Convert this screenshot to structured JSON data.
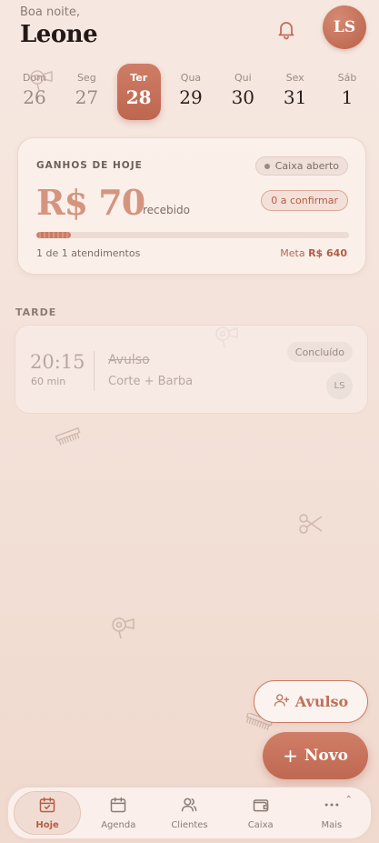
{
  "header": {
    "greeting": "Boa noite,",
    "user_name": "Leone",
    "avatar_initials": "LS",
    "bell_icon": "bell-icon"
  },
  "week": [
    {
      "name": "Dom",
      "date": "26",
      "state": "past"
    },
    {
      "name": "Seg",
      "date": "27",
      "state": "past"
    },
    {
      "name": "Ter",
      "date": "28",
      "state": "active"
    },
    {
      "name": "Qua",
      "date": "29",
      "state": "future"
    },
    {
      "name": "Qui",
      "date": "30",
      "state": "future"
    },
    {
      "name": "Sex",
      "date": "31",
      "state": "future"
    },
    {
      "name": "Sáb",
      "date": "1",
      "state": "future"
    }
  ],
  "earnings": {
    "title": "GANHOS DE HOJE",
    "cash_status": "Caixa aberto",
    "amount": "R$ 70",
    "amount_label": "recebido",
    "to_confirm": "0 a confirmar",
    "progress_fraction": 0.11,
    "attendance_text": "1 de 1 atendimentos",
    "goal_label": "Meta",
    "goal_value": "R$ 640"
  },
  "section": {
    "title": "TARDE"
  },
  "appointment": {
    "time": "20:15",
    "duration": "60 min",
    "client": "Avulso",
    "service": "Corte + Barba",
    "status": "Concluído",
    "initials": "LS"
  },
  "actions": {
    "walkin_label": "Avulso",
    "new_label": "Novo",
    "new_plus": "+"
  },
  "nav": [
    {
      "label": "Hoje",
      "icon": "calendar-check-icon",
      "active": true
    },
    {
      "label": "Agenda",
      "icon": "calendar-icon",
      "active": false
    },
    {
      "label": "Clientes",
      "icon": "users-icon",
      "active": false
    },
    {
      "label": "Caixa",
      "icon": "wallet-icon",
      "active": false
    },
    {
      "label": "Mais",
      "icon": "more-icon",
      "active": false
    }
  ],
  "colors": {
    "accent": "#c46d56",
    "background": "#f5e6df",
    "muted_text": "#8a7b74"
  }
}
